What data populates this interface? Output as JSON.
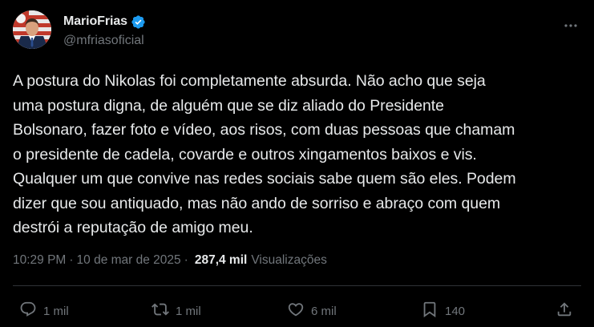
{
  "author": {
    "display_name": "MarioFrias",
    "handle": "@mfriasoficial",
    "verified": true,
    "verified_color": "#1d9bf0"
  },
  "tweet": {
    "text": "A postura do Nikolas foi completamente absurda. Não acho que seja\numa postura digna, de alguém que se diz aliado do Presidente\nBolsonaro, fazer foto e vídeo, aos risos, com duas pessoas que chamam\no presidente de cadela, covarde e outros xingamentos baixos e vis.\nQualquer um que convive nas redes sociais sabe quem são eles. Podem\ndizer que sou antiquado, mas não ando de sorriso e abraço com quem\ndestrói a reputação de amigo meu."
  },
  "meta": {
    "time": "10:29 PM",
    "separator": "·",
    "date": "10 de mar de 2025",
    "views_count": "287,4 mil",
    "views_label": "Visualizações"
  },
  "actions": {
    "reply": {
      "icon": "reply-icon",
      "count": "1 mil"
    },
    "repost": {
      "icon": "repost-icon",
      "count": "1 mil"
    },
    "like": {
      "icon": "heart-icon",
      "count": "6 mil"
    },
    "bookmark": {
      "icon": "bookmark-icon",
      "count": "140"
    },
    "share": {
      "icon": "share-icon"
    }
  },
  "colors": {
    "background": "#000000",
    "text": "#e7e9ea",
    "secondary": "#71767b",
    "divider": "#2f3336"
  }
}
